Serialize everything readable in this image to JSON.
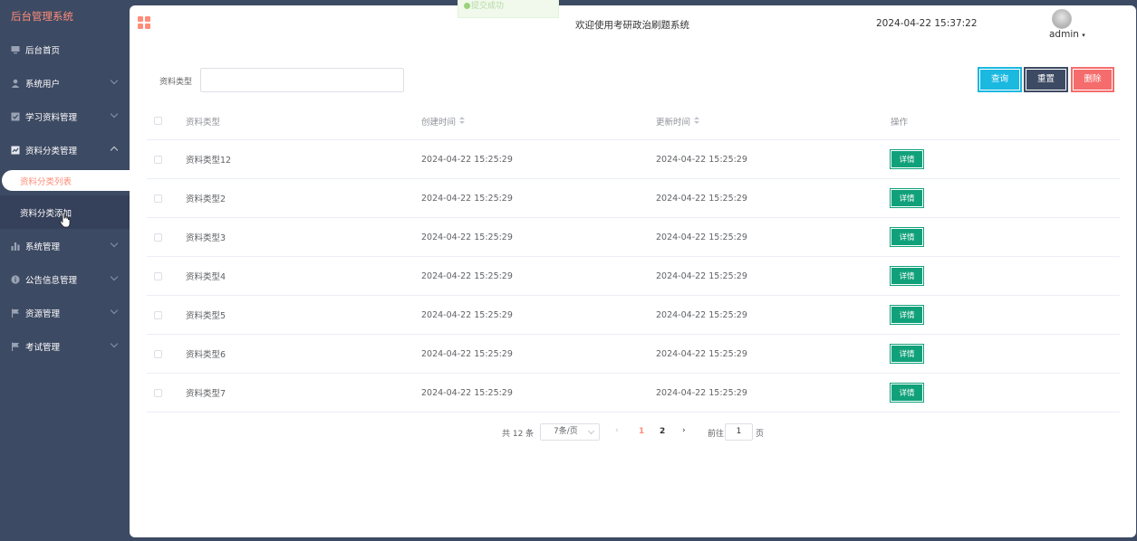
{
  "sidebar": {
    "brand": "后台管理系统",
    "items": [
      {
        "label": "后台首页",
        "icon": "monitor-icon",
        "has_caret": false
      },
      {
        "label": "系统用户",
        "icon": "user-icon",
        "has_caret": true
      },
      {
        "label": "学习资料管理",
        "icon": "checkbox-icon",
        "has_caret": true
      },
      {
        "label": "资料分类管理",
        "icon": "chart-box-icon",
        "has_caret": true,
        "expanded": true
      }
    ],
    "sub_items": [
      {
        "label": "资料分类列表",
        "active": true
      },
      {
        "label": "资料分类添加",
        "active": false
      }
    ],
    "items_after": [
      {
        "label": "系统管理",
        "icon": "bar-chart-icon"
      },
      {
        "label": "公告信息管理",
        "icon": "info-icon"
      },
      {
        "label": "资源管理",
        "icon": "flag-icon"
      },
      {
        "label": "考试管理",
        "icon": "flag-icon"
      }
    ]
  },
  "header": {
    "welcome": "欢迎使用考研政治刷题系统",
    "datetime": "2024-04-22 15:37:22",
    "user": "admin",
    "toast": "提交成功"
  },
  "filter": {
    "label": "资料类型",
    "value": "",
    "query_label": "查询",
    "reset_label": "重置",
    "delete_label": "删除"
  },
  "table": {
    "columns": {
      "type": "资料类型",
      "created": "创建时间",
      "updated": "更新时间",
      "op": "操作"
    },
    "detail_label": "详情",
    "rows": [
      {
        "type": "资料类型12",
        "created": "2024-04-22 15:25:29",
        "updated": "2024-04-22 15:25:29"
      },
      {
        "type": "资料类型2",
        "created": "2024-04-22 15:25:29",
        "updated": "2024-04-22 15:25:29"
      },
      {
        "type": "资料类型3",
        "created": "2024-04-22 15:25:29",
        "updated": "2024-04-22 15:25:29"
      },
      {
        "type": "资料类型4",
        "created": "2024-04-22 15:25:29",
        "updated": "2024-04-22 15:25:29"
      },
      {
        "type": "资料类型5",
        "created": "2024-04-22 15:25:29",
        "updated": "2024-04-22 15:25:29"
      },
      {
        "type": "资料类型6",
        "created": "2024-04-22 15:25:29",
        "updated": "2024-04-22 15:25:29"
      },
      {
        "type": "资料类型7",
        "created": "2024-04-22 15:25:29",
        "updated": "2024-04-22 15:25:29"
      }
    ]
  },
  "pagination": {
    "total": "共 12 条",
    "page_size": "7条/页",
    "page1": "1",
    "page2": "2",
    "goto_label": "前往",
    "goto_value": "1",
    "goto_unit": "页",
    "prev": "‹",
    "next": "›"
  },
  "colors": {
    "sidebar_bg": "#3d4a63",
    "accent": "#ff8d7a",
    "query": "#1bb8e0",
    "delete": "#f56c6c",
    "detail": "#11a17a"
  }
}
